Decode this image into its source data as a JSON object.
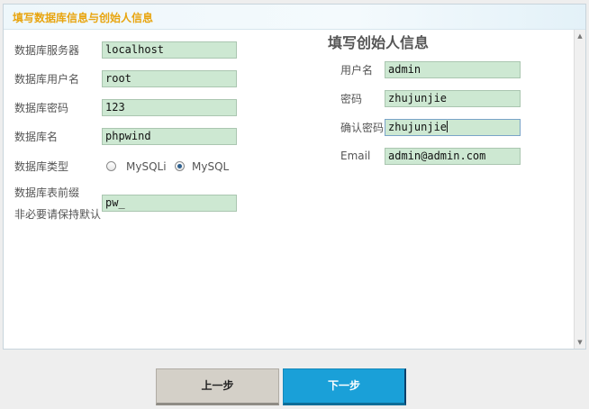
{
  "header": {
    "title": "填写数据库信息与创始人信息"
  },
  "database": {
    "server_label": "数据库服务器",
    "server_value": "localhost",
    "user_label": "数据库用户名",
    "user_value": "root",
    "password_label": "数据库密码",
    "password_value": "123",
    "name_label": "数据库名",
    "name_value": "phpwind",
    "type_label": "数据库类型",
    "type_options": [
      {
        "label": "MySQLi",
        "checked": false
      },
      {
        "label": "MySQL",
        "checked": true
      }
    ],
    "prefix_label_line1": "数据库表前缀",
    "prefix_label_line2": "非必要请保持默认",
    "prefix_value": "pw_"
  },
  "founder": {
    "section_title": "填写创始人信息",
    "username_label": "用户名",
    "username_value": "admin",
    "password_label": "密码",
    "password_value": "zhujunjie",
    "confirm_label": "确认密码",
    "confirm_value": "zhujunjie",
    "email_label": "Email",
    "email_value": "admin@admin.com"
  },
  "buttons": {
    "prev_label": "上一步",
    "next_label": "下一步"
  },
  "colors": {
    "header_title": "#e8a510",
    "field_background": "#cde8d2",
    "next_button": "#1aa0d8",
    "prev_button": "#d4d0c8"
  }
}
